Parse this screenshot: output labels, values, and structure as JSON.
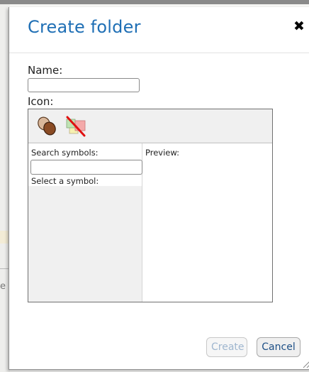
{
  "dialog": {
    "title": "Create folder",
    "close_glyph": "✖"
  },
  "form": {
    "name_label": "Name:",
    "name_value": "",
    "icon_label": "Icon:"
  },
  "icon_toolbar": {
    "icons": [
      {
        "name": "brown-stones-icon"
      },
      {
        "name": "no-icon-icon"
      }
    ]
  },
  "symbols": {
    "search_label": "Search symbols:",
    "search_value": "",
    "select_label": "Select a symbol:",
    "preview_label": "Preview:"
  },
  "buttons": {
    "create_label": "Create",
    "cancel_label": "Cancel"
  },
  "background": {
    "partial_text": "e"
  },
  "colors": {
    "title": "#1f6fb5",
    "create_disabled": "#9fb6cf",
    "cancel_text": "#1d4f86"
  }
}
